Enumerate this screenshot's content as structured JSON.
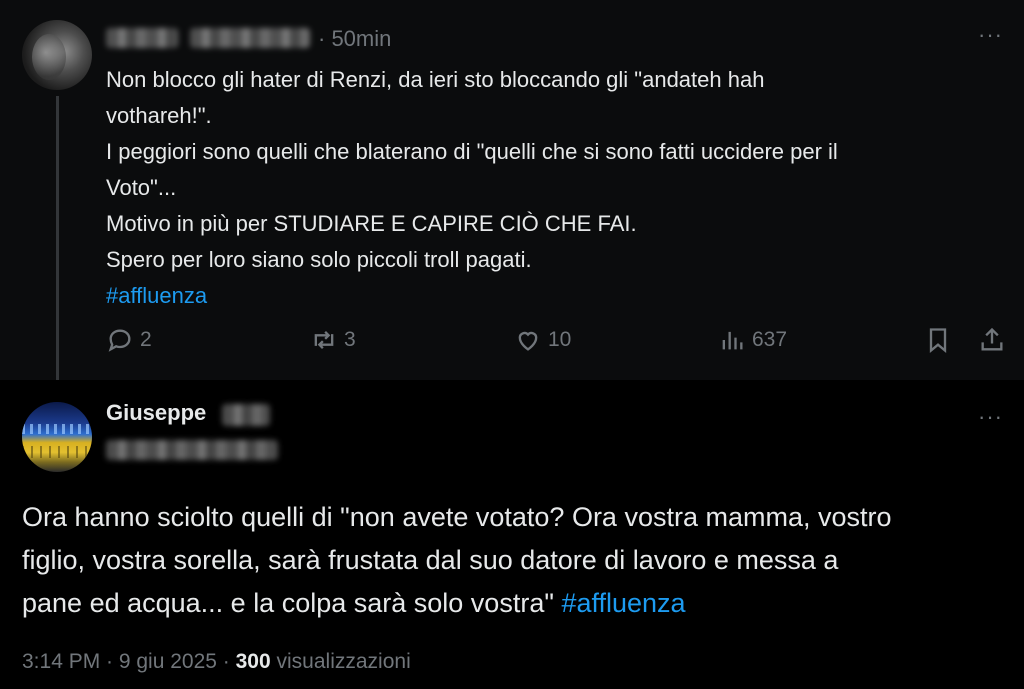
{
  "tweet1": {
    "time": "· 50min",
    "more": "···",
    "lines": [
      "Non blocco gli hater di Renzi, da ieri sto bloccando gli \"andateh hah",
      "vothareh!\".",
      "I peggiori sono quelli che blaterano di \"quelli che si sono fatti uccidere per il",
      "Voto\"...",
      "Motivo in più per STUDIARE E CAPIRE CIÒ CHE FAI.",
      "Spero per loro siano solo piccoli troll pagati."
    ],
    "hashtag": "#affluenza",
    "actions": {
      "replies": "2",
      "reposts": "3",
      "likes": "10",
      "views": "637"
    }
  },
  "tweet2": {
    "name": "Giuseppe",
    "more": "···",
    "lines": [
      "Ora hanno sciolto quelli di \"non avete votato? Ora vostra mamma, vostro",
      "figlio, vostra sorella, sarà frustata dal suo datore di lavoro e messa a"
    ],
    "last_line": "pane ed acqua... e la colpa sarà solo vostra\"",
    "hashtag": "#affluenza",
    "meta": {
      "time": "3:14 PM · 9 giu 2025 · ",
      "views_count": "300",
      "views_label": "visualizzazioni"
    }
  },
  "colors": {
    "link": "#1d9bf0",
    "muted": "#71767b",
    "text": "#e7e9ea"
  }
}
